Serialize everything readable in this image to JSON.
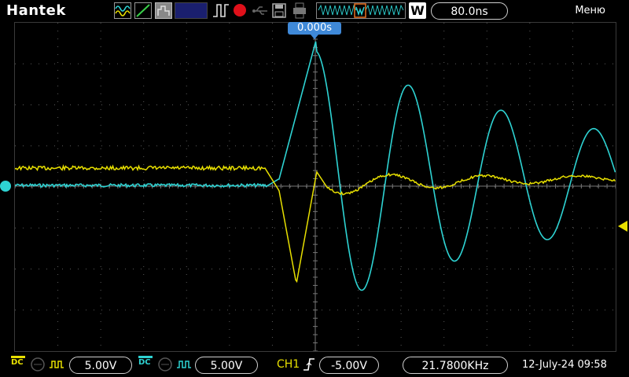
{
  "topbar": {
    "brand": "Hantek",
    "timebase": "80.0ns",
    "menu_label": "Меню",
    "icons": [
      "waveform-mode-icon",
      "line-display-icon",
      "persist-icon",
      "run-pulse-icon",
      "stop-record-icon",
      "usb-icon",
      "save-icon",
      "print-icon",
      "memory-window-icon",
      "trigger-w-icon"
    ]
  },
  "screen": {
    "trigger_position": "0.000s",
    "ch1_color": "#e8e000",
    "ch2_color": "#2ed3d3",
    "grid_color": "#5a5a5a"
  },
  "bottombar": {
    "ch1_coupling": "DC",
    "ch1_scale": "5.00V",
    "ch2_coupling": "DC",
    "ch2_scale": "5.00V",
    "trigger_source": "CH1",
    "trigger_level": "-5.00V",
    "frequency": "21.7800KHz",
    "datetime": "12-July-24 09:58"
  }
}
